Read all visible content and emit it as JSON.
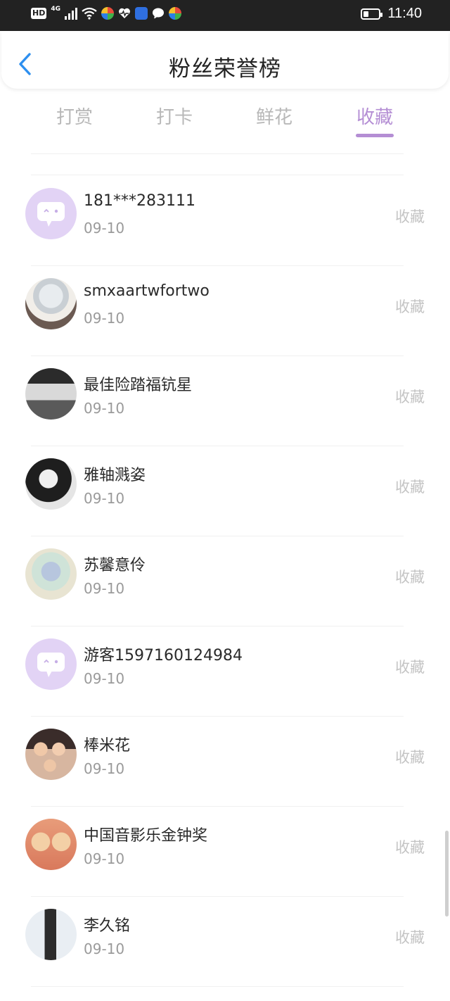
{
  "status_bar": {
    "hd": "HD",
    "network": "4G",
    "time": "11:40"
  },
  "header": {
    "title": "粉丝荣誉榜"
  },
  "tabs": [
    {
      "label": "打赏",
      "active": false
    },
    {
      "label": "打卡",
      "active": false
    },
    {
      "label": "鲜花",
      "active": false
    },
    {
      "label": "收藏",
      "active": true
    }
  ],
  "accent_color": "#b48ed4",
  "list": [
    {
      "name": "181***283111",
      "date": "09-10",
      "action": "收藏",
      "avatar": "default-chat-avatar"
    },
    {
      "name": "smxaartwfortwo",
      "date": "09-10",
      "action": "收藏",
      "avatar": "photo-avatar"
    },
    {
      "name": "最佳险踏福钪星",
      "date": "09-10",
      "action": "收藏",
      "avatar": "photo-avatar"
    },
    {
      "name": "雅轴溅姿",
      "date": "09-10",
      "action": "收藏",
      "avatar": "photo-avatar"
    },
    {
      "name": "苏馨意伶",
      "date": "09-10",
      "action": "收藏",
      "avatar": "photo-avatar"
    },
    {
      "name": "游客1597160124984",
      "date": "09-10",
      "action": "收藏",
      "avatar": "default-chat-avatar"
    },
    {
      "name": "棒米花",
      "date": "09-10",
      "action": "收藏",
      "avatar": "photo-avatar"
    },
    {
      "name": "中国音影乐金钟奖",
      "date": "09-10",
      "action": "收藏",
      "avatar": "photo-avatar"
    },
    {
      "name": "李久铭",
      "date": "09-10",
      "action": "收藏",
      "avatar": "photo-avatar"
    }
  ]
}
